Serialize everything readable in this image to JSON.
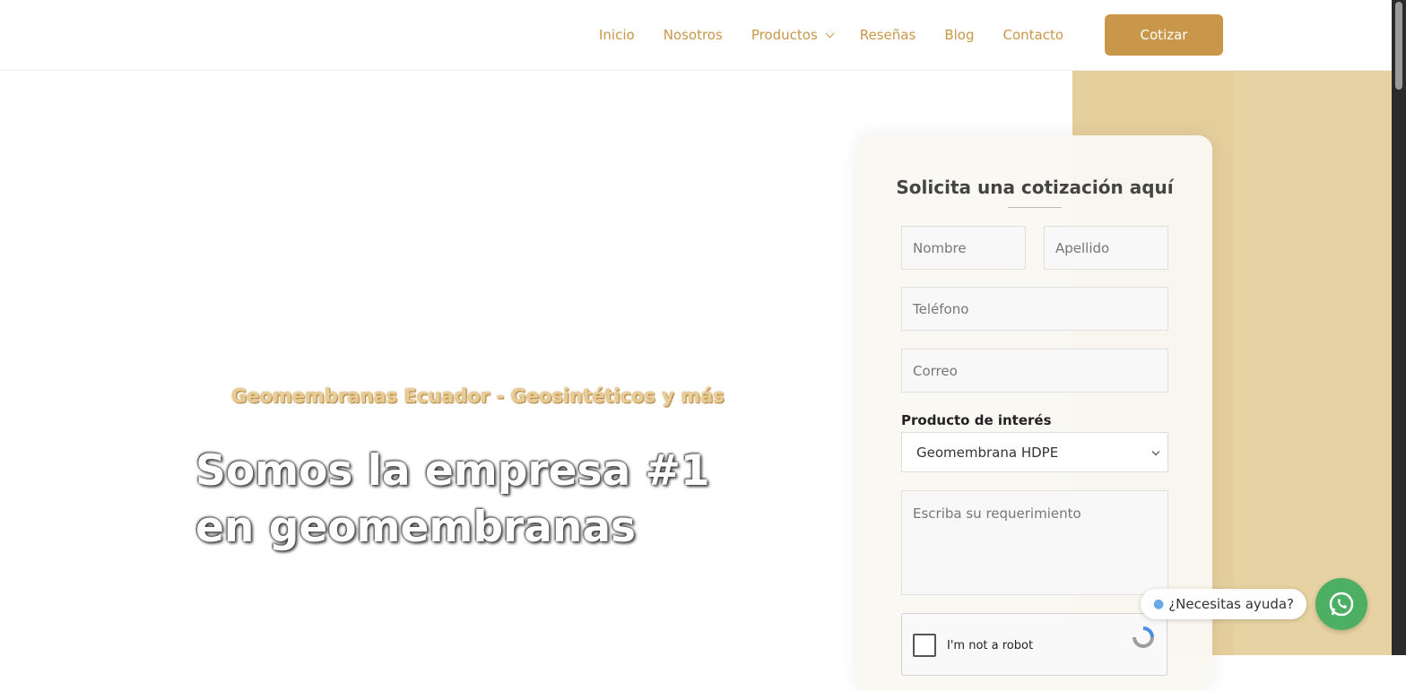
{
  "nav": {
    "items": [
      {
        "label": "Inicio"
      },
      {
        "label": "Nosotros"
      },
      {
        "label": "Productos"
      },
      {
        "label": "Reseñas"
      },
      {
        "label": "Blog"
      },
      {
        "label": "Contacto"
      }
    ],
    "cta_label": "Cotizar"
  },
  "hero": {
    "subtitle": "Geomembranas Ecuador - Geosintéticos y más",
    "title_line1": "Somos la empresa #1",
    "title_line2": "en geomembranas"
  },
  "form": {
    "title": "Solicita una cotización aquí",
    "first_name_placeholder": "Nombre",
    "last_name_placeholder": "Apellido",
    "phone_placeholder": "Teléfono",
    "email_placeholder": "Correo",
    "product_label": "Producto de interés",
    "product_selected": "Geomembrana HDPE",
    "message_placeholder": "Escriba su requerimiento",
    "recaptcha_label": "I'm not a robot"
  },
  "chat": {
    "help_text": "¿Necesitas ayuda?",
    "icon": "whatsapp-icon"
  },
  "colors": {
    "accent": "#c9974a",
    "band": "#e6d2a2",
    "whatsapp": "#4caf63"
  }
}
